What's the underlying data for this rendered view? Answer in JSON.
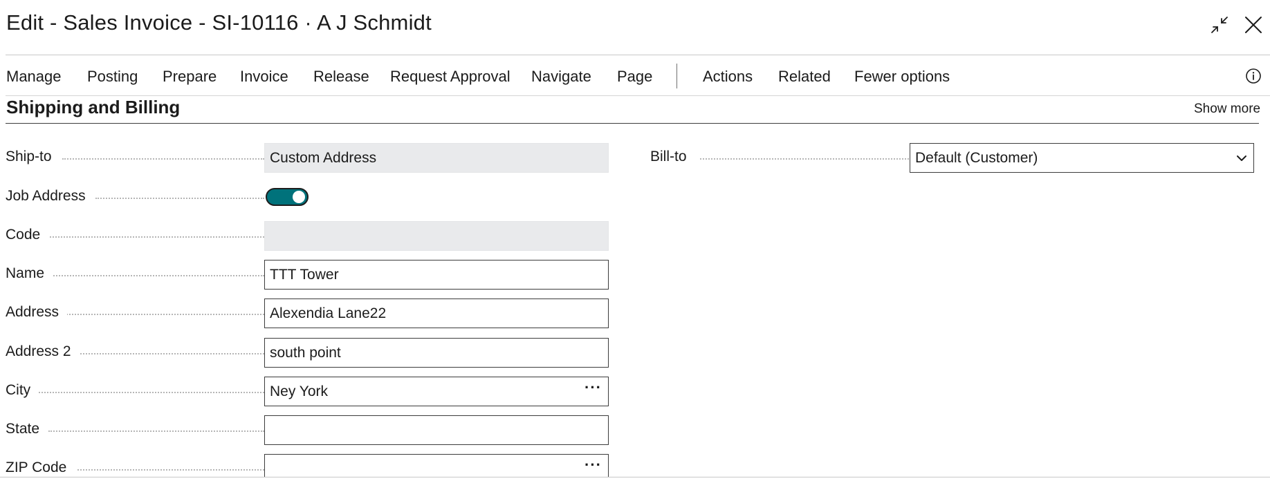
{
  "window": {
    "title": "Edit - Sales Invoice - SI-10116 · A J Schmidt",
    "collapse_icon": "collapse-arrows-icon",
    "close_icon": "close-icon"
  },
  "actions": {
    "items": [
      "Manage",
      "Posting",
      "Prepare",
      "Invoice",
      "Release",
      "Request Approval",
      "Navigate",
      "Page",
      "Actions",
      "Related",
      "Fewer options"
    ],
    "info_icon": "info-icon"
  },
  "section": {
    "title": "Shipping and Billing",
    "show_more": "Show more"
  },
  "fields": {
    "ship_to": {
      "label": "Ship-to",
      "value": "Custom Address"
    },
    "job_address": {
      "label": "Job Address",
      "on": true
    },
    "code": {
      "label": "Code",
      "value": ""
    },
    "name": {
      "label": "Name",
      "value": "TTT Tower"
    },
    "address": {
      "label": "Address",
      "value": "Alexendia Lane22"
    },
    "address2": {
      "label": "Address 2",
      "value": "south point"
    },
    "city": {
      "label": "City",
      "value": "Ney York",
      "lookup": "···"
    },
    "state": {
      "label": "State",
      "value": ""
    },
    "zip": {
      "label": "ZIP Code",
      "value": "",
      "lookup": "···"
    },
    "bill_to": {
      "label": "Bill-to",
      "value": "Default (Customer)"
    }
  },
  "colors": {
    "toggle_on": "#00727b",
    "readonly_bg": "#e9eaec"
  }
}
